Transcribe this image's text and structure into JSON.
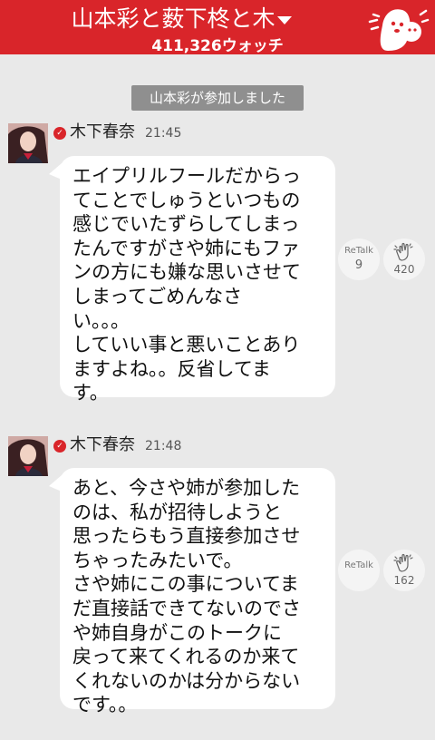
{
  "header": {
    "title": "山本彩と薮下柊と木",
    "watch_count": "411,326ウォッチ"
  },
  "system_message": "山本彩が参加しました",
  "messages": [
    {
      "sender": "木下春奈",
      "time": "21:45",
      "text": "エイプリルフールだからっ\nてことでしゅうといつもの\n感じでいたずらしてしまっ\nたんですがさや姉にもファ\nンの方にも嫌な思いさせて\nしまってごめんなさ\nい。。。\nしていい事と悪いことあり\nますよね。。反省してま\nす。",
      "retalk_label": "ReTalk",
      "retalk_count": "9",
      "clap_count": "420"
    },
    {
      "sender": "木下春奈",
      "time": "21:48",
      "text": "あと、今さや姉が参加した\nのは、私が招待しようと\n思ったらもう直接参加させ\nちゃったみたいで。\nさや姉にこの事についてま\nだ直接話できてないのでさ\nや姉自身がこのトークに\n戻って来てくれるのか来て\nくれないのかは分からない\nです。。",
      "retalk_label": "ReTalk",
      "retalk_count": "",
      "clap_count": "162"
    }
  ],
  "colors": {
    "accent": "#d9252a",
    "background": "#e9e9e9",
    "bubble": "#ffffff",
    "system_pill": "#8f8f8f"
  },
  "icons": [
    "dropdown-triangle-icon",
    "mascot-icon",
    "verified-check-icon",
    "clap-hands-icon"
  ]
}
